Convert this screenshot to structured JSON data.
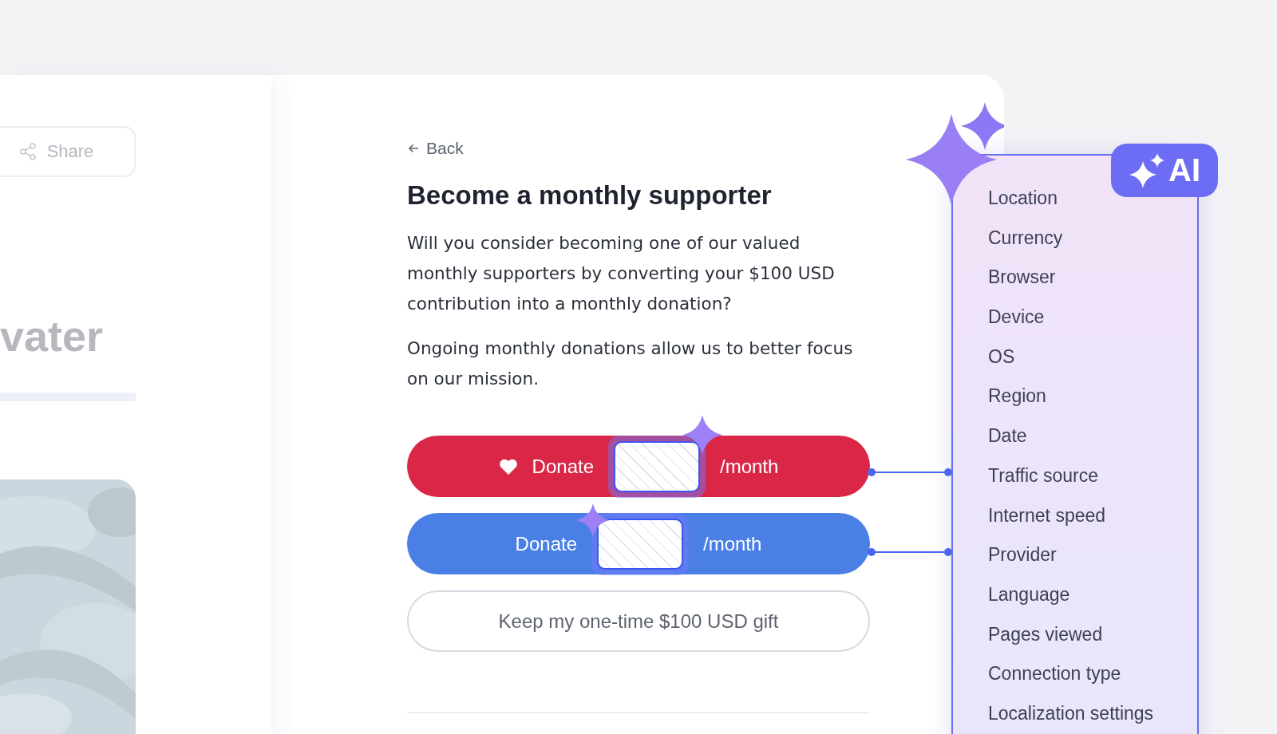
{
  "left_panel": {
    "share_button": "Share",
    "heading": "vater",
    "progress": {
      "level": 0
    }
  },
  "back_link": "Back",
  "title": "Become a monthly supporter",
  "paragraphs": [
    "Will you consider becoming one of our valued monthly supporters by converting your $100 USD contribution into a monthly donation?",
    "Ongoing monthly donations allow us to better focus on our mission."
  ],
  "donate_buttons": [
    {
      "kind": "heart",
      "label": "Donate",
      "suffix": "/month",
      "color": "#db2747"
    },
    {
      "kind": "plain",
      "label": "Donate",
      "suffix": "/month",
      "color": "#4a80e6"
    }
  ],
  "secondary_button": "Keep my one-time $100 USD gift",
  "ai_panel": {
    "badge": "AI",
    "items": [
      "Location",
      "Currency",
      "Browser",
      "Device",
      "OS",
      "Region",
      "Date",
      "Traffic source",
      "Internet speed",
      "Provider",
      "Language",
      "Pages viewed",
      "Connection type",
      "Localization settings"
    ]
  }
}
